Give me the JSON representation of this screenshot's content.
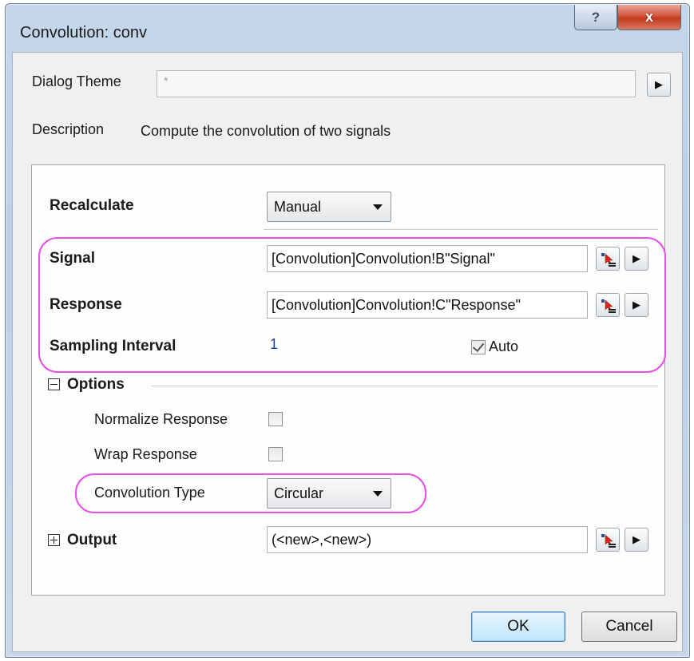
{
  "window": {
    "title": "Convolution: conv",
    "help_label": "?",
    "close_label": "x"
  },
  "theme": {
    "label": "Dialog Theme",
    "value": "*"
  },
  "description": {
    "label": "Description",
    "text": "Compute the convolution of two signals"
  },
  "recalculate": {
    "label": "Recalculate",
    "selected": "Manual"
  },
  "signal": {
    "label": "Signal",
    "value": "[Convolution]Convolution!B\"Signal\""
  },
  "response": {
    "label": "Response",
    "value": "[Convolution]Convolution!C\"Response\""
  },
  "sampling": {
    "label": "Sampling Interval",
    "value": "1",
    "auto_label": "Auto",
    "auto_checked": true
  },
  "options": {
    "label": "Options",
    "expanded": true,
    "normalize_label": "Normalize Response",
    "normalize_checked": false,
    "wrap_label": "Wrap Response",
    "wrap_checked": false,
    "conv_type_label": "Convolution Type",
    "conv_type_selected": "Circular"
  },
  "output": {
    "label": "Output",
    "expanded": false,
    "value": "(<new>,<new>)"
  },
  "buttons": {
    "ok": "OK",
    "cancel": "Cancel"
  },
  "colors": {
    "highlight": "#e84ee6",
    "sampling_value": "#1f3fa0"
  },
  "icons": [
    "help-icon",
    "close-icon",
    "arrow-right-icon",
    "select-range-icon",
    "dropdown-arrow-icon",
    "checkmark-icon",
    "collapse-icon",
    "expand-icon"
  ]
}
